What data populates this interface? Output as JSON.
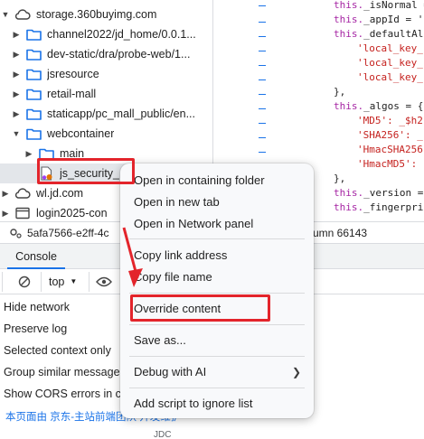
{
  "tree": {
    "root": "storage.360buyimg.com",
    "items": [
      {
        "label": "channel2022/jd_home/0.0.1..."
      },
      {
        "label": "dev-static/dra/probe-web/1..."
      },
      {
        "label": "jsresource"
      },
      {
        "label": "retail-mall"
      },
      {
        "label": "staticapp/pc_mall_public/en..."
      },
      {
        "label": "webcontainer"
      },
      {
        "label": "main"
      },
      {
        "label": "js_security_"
      },
      {
        "label": "wl.jd.com"
      },
      {
        "label": "login2025-con"
      }
    ]
  },
  "code": {
    "lines": [
      {
        "a": "this.",
        "b": "_isNormal ="
      },
      {
        "a": "this.",
        "b": "_appId = '"
      },
      {
        "a": "this.",
        "b": "_defaultAlg"
      },
      {
        "s": "'local_key_"
      },
      {
        "s": "'local_key_"
      },
      {
        "s": "'local_key_"
      },
      {
        "p": "},"
      },
      {
        "a": "this.",
        "b": "_algos = {"
      },
      {
        "s": "'MD5': _$h2"
      },
      {
        "s": "'SHA256': _"
      },
      {
        "s": "'HmacSHA256"
      },
      {
        "s": "'HmacMD5': "
      },
      {
        "p": "},"
      },
      {
        "a": "this.",
        "b": "_version ="
      },
      {
        "a": "this.",
        "b": "_fingerprin"
      }
    ]
  },
  "statusbar": {
    "left": "5afa7566-e2ff-4c",
    "right": "umn 66143"
  },
  "drawer": {
    "tab": "Console",
    "context": "top",
    "options": [
      "Hide network",
      "Preserve log",
      "Selected context only",
      "Group similar message",
      "Show CORS errors in c"
    ],
    "footer": "本页面由  京东-主站前端团队 开发维护",
    "footer2": "JDC"
  },
  "context_menu": {
    "items": [
      "Open in containing folder",
      "Open in new tab",
      "Open in Network panel",
      "Copy link address",
      "Copy file name",
      "Override content",
      "Save as...",
      "Debug with AI",
      "Add script to ignore list"
    ]
  },
  "colors": {
    "annotation": "#e3242b",
    "folder": "#1a73e8",
    "accent": "#1a73e8"
  }
}
